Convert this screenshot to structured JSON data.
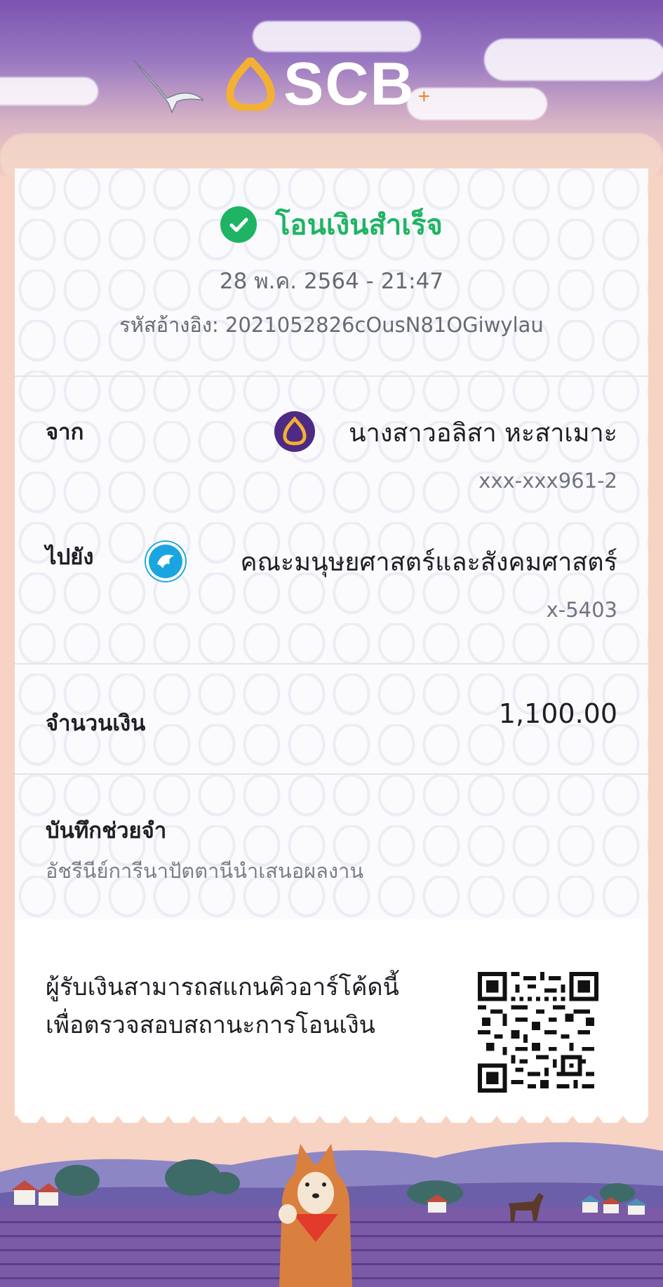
{
  "header": {
    "brand": "SCB",
    "brand_suffix": "+"
  },
  "receipt": {
    "status": "โอนเงินสำเร็จ",
    "datetime": "28 พ.ค. 2564 - 21:47",
    "reference_label": "รหัสอ้างอิง:",
    "reference_value": "2021052826cOusN81OGiwylau",
    "from": {
      "label": "จาก",
      "name": "นางสาวอลิสา หะสาเมาะ",
      "account": "xxx-xxx961-2",
      "bank_icon": "scb-bank-icon"
    },
    "to": {
      "label": "ไปยัง",
      "name": "คณะมนุษยศาสตร์และสังคมศาสตร์",
      "account": "x-5403",
      "bank_icon": "ktb-bank-icon"
    },
    "amount": {
      "label": "จำนวนเงิน",
      "value": "1,100.00"
    },
    "memo": {
      "label": "บันทึกช่วยจำ",
      "value": "อัชรีนีย์การีนาปัตตานีนำเสนอผลงาน"
    },
    "qr_note": {
      "line1": "ผู้รับเงินสามารถสแกนคิวอาร์โค้ดนี้",
      "line2": "เพื่อตรวจสอบสถานะการโอนเงิน"
    }
  },
  "colors": {
    "success": "#1fb464",
    "scb_purple": "#4e2a84",
    "scb_gold": "#f2b134",
    "ktb_blue": "#1ba5e0"
  }
}
